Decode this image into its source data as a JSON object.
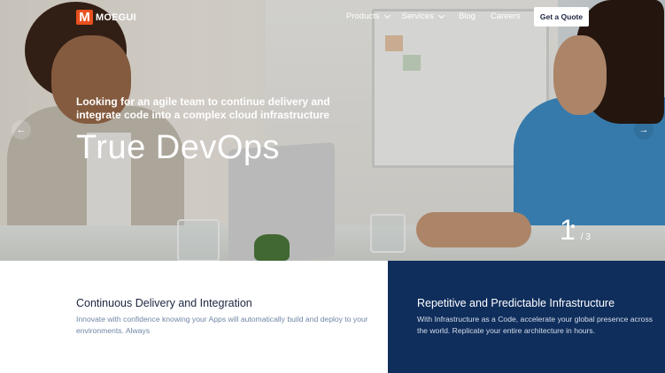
{
  "brand": {
    "logo_mark": "M",
    "name": "MOEGUI",
    "accent": "#e8501f"
  },
  "nav": {
    "items": [
      {
        "label": "Products",
        "dropdown": true
      },
      {
        "label": "Services",
        "dropdown": true
      },
      {
        "label": "Blog",
        "dropdown": false
      },
      {
        "label": "Careers",
        "dropdown": false
      }
    ],
    "cta_label": "Get a Quote"
  },
  "hero": {
    "subtitle": "Looking for an agile team to continue delivery and integrate code into a complex cloud infrastructure",
    "title": "True DevOps",
    "prev_icon": "arrow-left-icon",
    "next_icon": "arrow-right-icon",
    "slide_current": "1",
    "slide_total": "/ 3"
  },
  "features": [
    {
      "title": "Continuous Delivery and Integration",
      "description": "Innovate with confidence knowing your Apps will automatically build and deploy to your environments. Always"
    },
    {
      "title": "Repetitive and Predictable Infrastructure",
      "description": "With Infrastructure as a Code, accelerate your global presence across the world. Replicate your entire architecture in hours."
    }
  ],
  "colors": {
    "dark_panel": "#0f2e5c",
    "heading": "#1b2540",
    "muted": "#6f86a6"
  }
}
